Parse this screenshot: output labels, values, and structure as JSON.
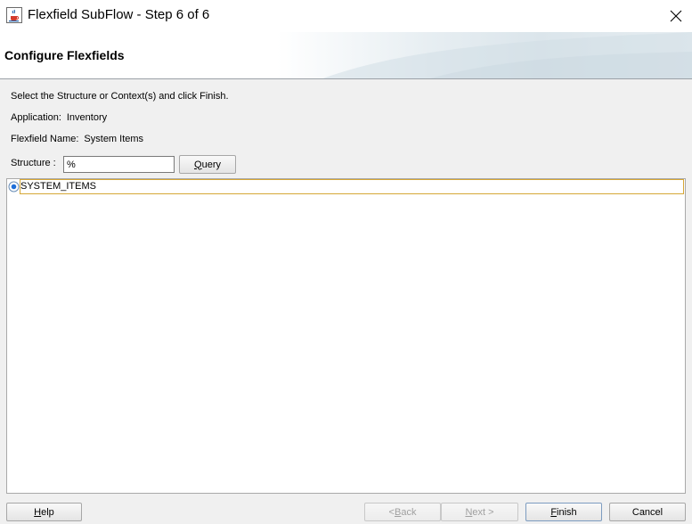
{
  "window": {
    "title": "Flexfield SubFlow - Step 6 of 6",
    "app_icon": "java-cup-icon",
    "close_icon": "close-icon"
  },
  "banner": {
    "title": "Configure Flexfields"
  },
  "form": {
    "instructions": "Select the Structure or Context(s) and click Finish.",
    "application_label": "Application:",
    "application_value": "Inventory",
    "flexfield_label": "Flexfield Name:",
    "flexfield_value": "System Items",
    "structure_label": "Structure :",
    "structure_value": "%",
    "query_button": {
      "mnemonic": "Q",
      "rest": "uery"
    }
  },
  "list": {
    "items": [
      {
        "label": "SYSTEM_ITEMS",
        "selected": true
      }
    ]
  },
  "footer": {
    "help": {
      "mnemonic": "H",
      "rest": "elp"
    },
    "back": {
      "prefix": "< ",
      "mnemonic": "B",
      "rest": "ack"
    },
    "next": {
      "mnemonic": "N",
      "rest": "ext >"
    },
    "finish": {
      "mnemonic": "F",
      "rest": "inish"
    },
    "cancel": {
      "label": "Cancel"
    }
  },
  "colors": {
    "selection_border": "#d6a736",
    "radio_accent": "#1e6fd9"
  }
}
